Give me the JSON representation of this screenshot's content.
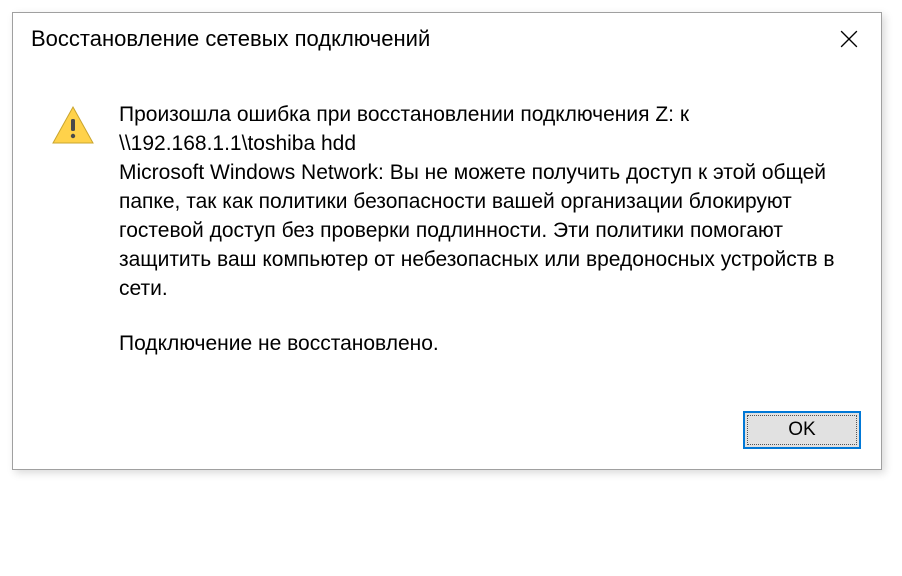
{
  "dialog": {
    "title": "Восстановление сетевых подключений",
    "message_main": "Произошла ошибка при восстановлении подключения Z: к \\\\192.168.1.1\\toshiba hdd\nMicrosoft Windows Network: Вы не можете получить доступ к этой общей папке, так как политики безопасности вашей организации блокируют гостевой доступ без проверки подлинности. Эти политики помогают защитить ваш компьютер от небезопасных или вредоносных устройств в сети.",
    "message_footer": "Подключение не восстановлено.",
    "ok_label": "OK"
  }
}
